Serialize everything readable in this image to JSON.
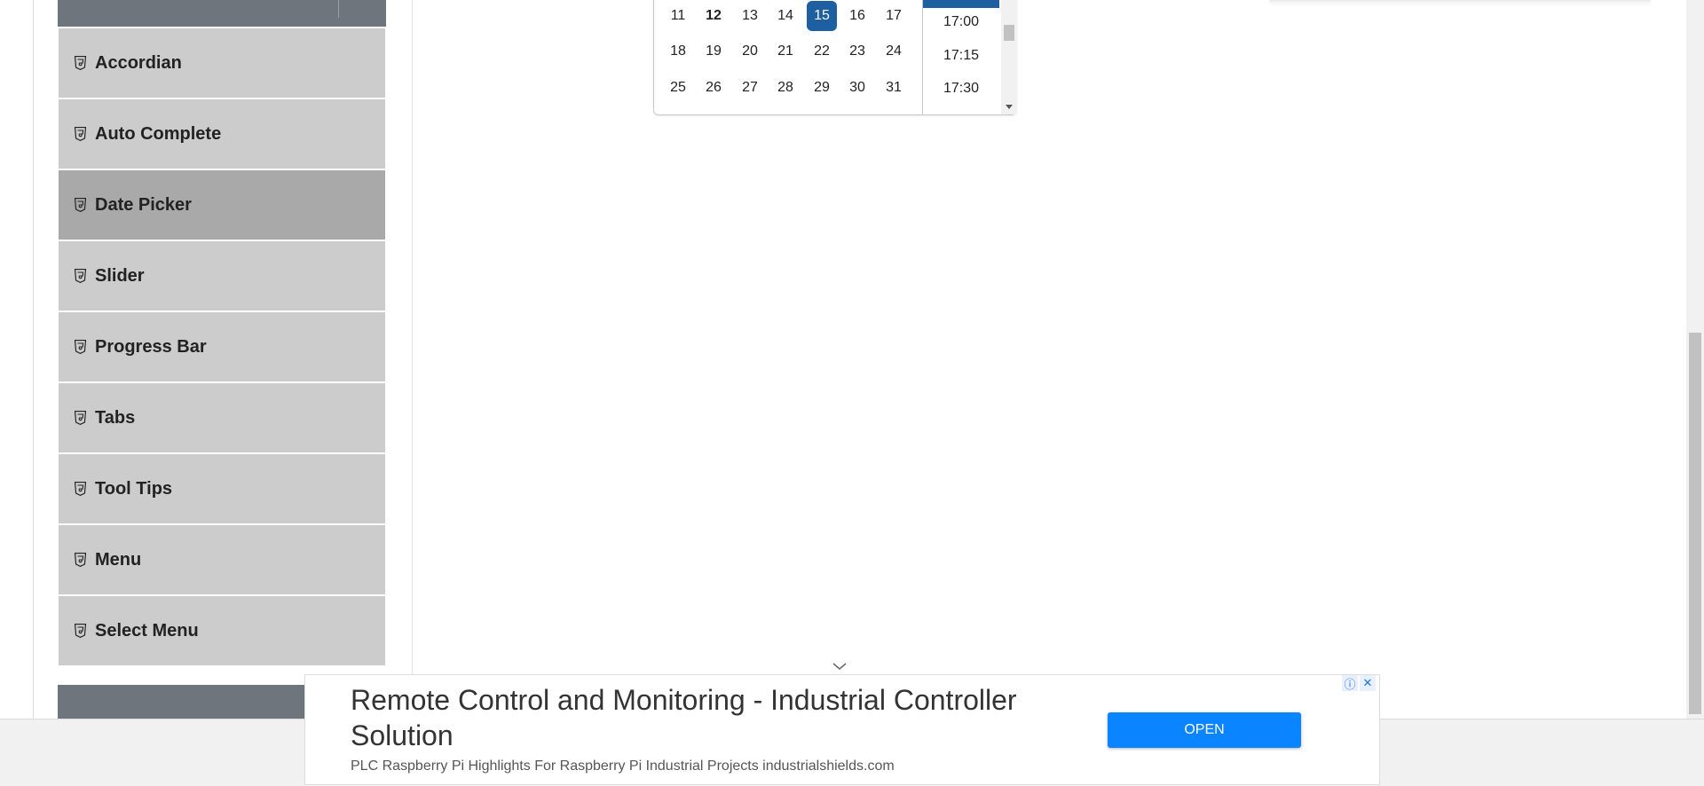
{
  "sidebar": {
    "items": [
      {
        "label": "Accordian"
      },
      {
        "label": "Auto Complete"
      },
      {
        "label": "Date Picker",
        "active": true
      },
      {
        "label": "Slider"
      },
      {
        "label": "Progress Bar"
      },
      {
        "label": "Tabs"
      },
      {
        "label": "Tool Tips"
      },
      {
        "label": "Menu"
      },
      {
        "label": "Select Menu"
      }
    ],
    "item_icon": "html5-icon"
  },
  "calendar": {
    "weeks": [
      [
        "11",
        "12",
        "13",
        "14",
        "15",
        "16",
        "17"
      ],
      [
        "18",
        "19",
        "20",
        "21",
        "22",
        "23",
        "24"
      ],
      [
        "25",
        "26",
        "27",
        "28",
        "29",
        "30",
        "31"
      ]
    ],
    "today": "12",
    "selected": "15",
    "times": [
      "17:00",
      "17:15",
      "17:30"
    ],
    "selected_color": "#1d5fa0"
  },
  "ad": {
    "title": "Remote Control and Monitoring - Industrial Controller Solution",
    "description": "PLC Raspberry Pi Highlights For Raspberry Pi Industrial Projects industrialshields.com",
    "button_label": "OPEN",
    "button_color": "#0a84ff",
    "info_icon": "ⓘ",
    "close_icon": "✕"
  }
}
